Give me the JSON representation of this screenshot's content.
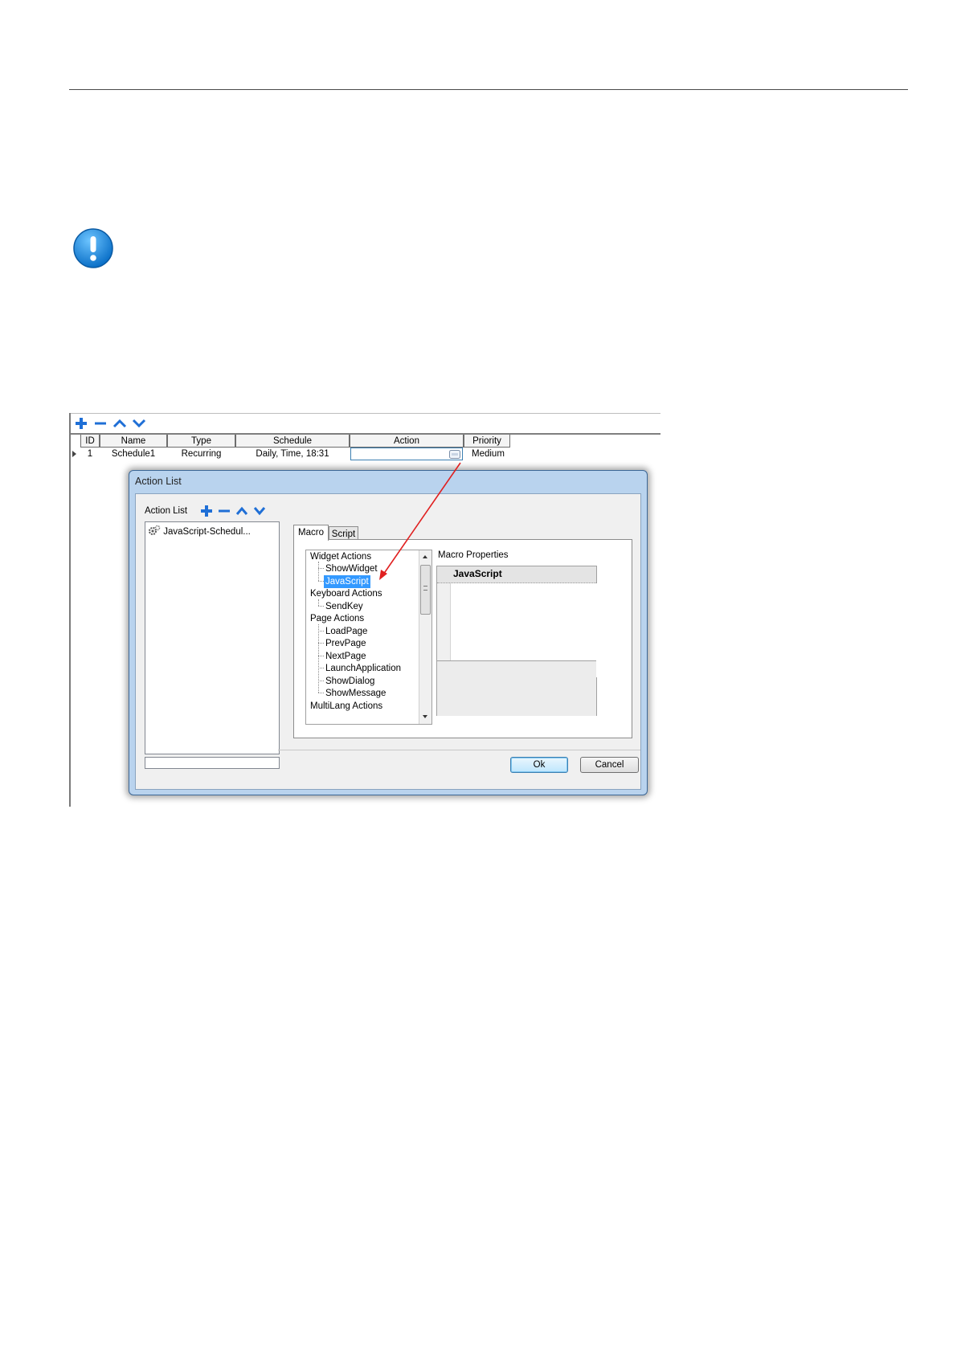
{
  "toolbar": {
    "add_icon": "plus-icon",
    "remove_icon": "minus-icon",
    "up_icon": "chevron-up-icon",
    "down_icon": "chevron-down-icon",
    "accent": "#1f6fd6"
  },
  "schedule_grid": {
    "columns": [
      "ID",
      "Name",
      "Type",
      "Schedule",
      "Action",
      "Priority"
    ],
    "rows": [
      {
        "id": "1",
        "name": "Schedule1",
        "type": "Recurring",
        "schedule": "Daily, Time, 18:31",
        "action": "",
        "priority": "Medium"
      }
    ]
  },
  "dialog": {
    "title": "Action List",
    "action_list_label": "Action List",
    "action_items": [
      "JavaScript-Schedul..."
    ],
    "tabs": [
      {
        "label": "Macro",
        "active": true
      },
      {
        "label": "Script",
        "active": false
      }
    ],
    "tree": [
      {
        "label": "Widget Actions",
        "kind": "category"
      },
      {
        "label": "ShowWidget",
        "kind": "leaf"
      },
      {
        "label": "JavaScript",
        "kind": "leaf",
        "selected": true
      },
      {
        "label": "Keyboard Actions",
        "kind": "category"
      },
      {
        "label": "SendKey",
        "kind": "leaf"
      },
      {
        "label": "Page Actions",
        "kind": "category"
      },
      {
        "label": "LoadPage",
        "kind": "leaf"
      },
      {
        "label": "PrevPage",
        "kind": "leaf"
      },
      {
        "label": "NextPage",
        "kind": "leaf"
      },
      {
        "label": "LaunchApplication",
        "kind": "leaf"
      },
      {
        "label": "ShowDialog",
        "kind": "leaf"
      },
      {
        "label": "ShowMessage",
        "kind": "leaf"
      },
      {
        "label": "MultiLang Actions",
        "kind": "category"
      }
    ],
    "macro_properties_label": "Macro Properties",
    "macro_properties_header": "JavaScript",
    "ok_label": "Ok",
    "cancel_label": "Cancel"
  },
  "colors": {
    "selection": "#3399ff",
    "arrow": "#e02020",
    "info_icon": "#1b8be0"
  }
}
